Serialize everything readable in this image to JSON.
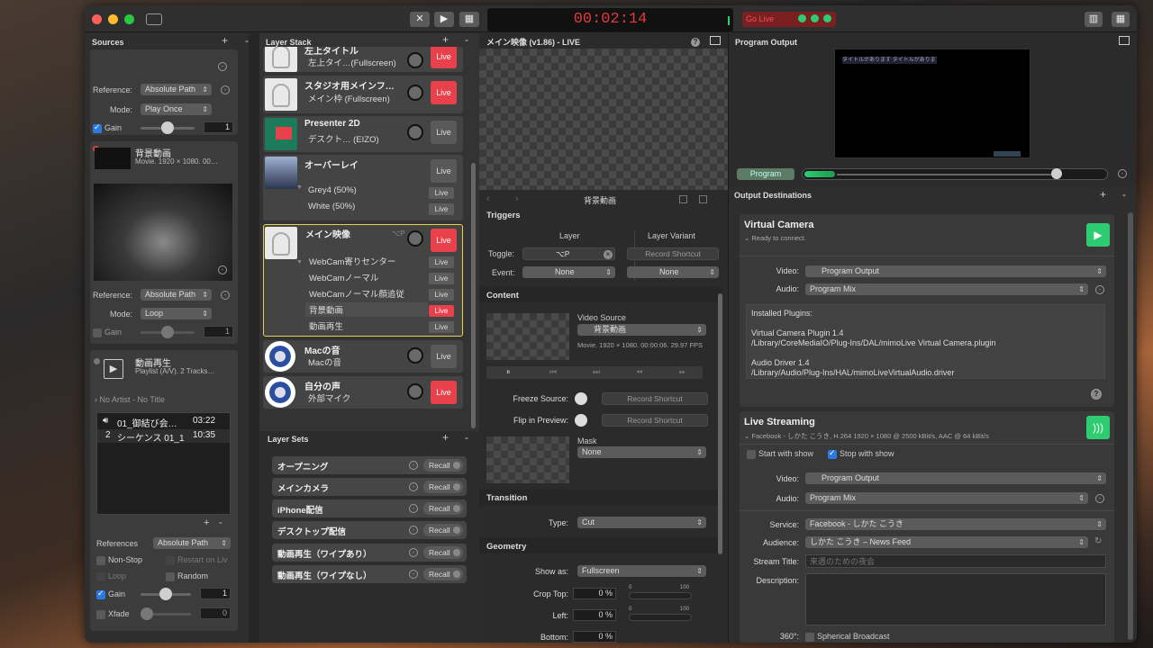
{
  "toolbar": {
    "timer": "00:02:14",
    "go_live_label": "Go Live"
  },
  "sources": {
    "header": "Sources",
    "video": {
      "reference_label": "Reference:",
      "reference_value": "Absolute Path",
      "mode_label": "Mode:",
      "mode_value": "Play Once",
      "gain_label": "Gain",
      "gain_value": "1"
    },
    "movie": {
      "title": "背景動画",
      "meta": "Movie. 1920 × 1080. 00…",
      "reference_label": "Reference:",
      "reference_value": "Absolute Path",
      "mode_label": "Mode:",
      "mode_value": "Loop",
      "gain_label": "Gain",
      "gain_value": "1"
    },
    "playlist": {
      "title": "動画再生",
      "meta": "Playlist (A/V). 2 Tracks…",
      "now_playing": "No Artist - No Title",
      "tracks": [
        {
          "num": "",
          "name": "01_御結び会…",
          "time": "03:22"
        },
        {
          "num": "2",
          "name": "シーケンス 01_1",
          "time": "10:35"
        }
      ],
      "references_label": "References",
      "references_value": "Absolute Path",
      "non_stop": "Non-Stop",
      "restart": "Restart on Liv",
      "loop": "Loop",
      "random": "Random",
      "gain_label": "Gain",
      "gain_value": "1",
      "xfade_label": "Xfade",
      "xfade_value": "0"
    }
  },
  "layer_stack": {
    "header": "Layer Stack",
    "live_label": "Live",
    "layers": [
      {
        "name": "左上タイトル",
        "sub": "左上タイ…(Fullscreen)"
      },
      {
        "name": "スタジオ用メインフ…",
        "sub": "メイン枠 (Fullscreen)"
      },
      {
        "name": "Presenter 2D",
        "sub": "デスクト… (EIZO)"
      },
      {
        "name": "オーバーレイ",
        "variants": [
          "Grey4 (50%)",
          "White (50%)"
        ]
      },
      {
        "name": "メイン映像",
        "shortcut": "⌥P",
        "variants": [
          "WebCam寄りセンター",
          "WebCamノーマル",
          "WebCamノーマル顔追従",
          "背景動画",
          "動画再生"
        ]
      },
      {
        "name": "Macの音",
        "sub": "Macの音"
      },
      {
        "name": "自分の声",
        "sub": "外部マイク"
      }
    ]
  },
  "layer_sets": {
    "header": "Layer Sets",
    "recall_label": "Recall",
    "items": [
      "オープニング",
      "メインカメラ",
      "iPhone配信",
      "デスクトップ配信",
      "動画再生（ワイプあり）",
      "動画再生（ワイプなし）"
    ]
  },
  "inspector": {
    "title": "メイン映像 (v1.86) - LIVE",
    "variant_title": "背景動画",
    "triggers": {
      "header": "Triggers",
      "col_layer": "Layer",
      "col_variant": "Layer Variant",
      "toggle_label": "Toggle:",
      "toggle_value": "⌥P",
      "record_shortcut": "Record Shortcut",
      "event_label": "Event:",
      "event_value": "None",
      "variant_event_value": "None"
    },
    "content": {
      "header": "Content",
      "video_source_label": "Video Source",
      "video_source_value": "背景動画",
      "meta": "Movie. 1920 × 1080. 00:00:06. 29.97 FPS",
      "freeze_label": "Freeze Source:",
      "flip_label": "Flip in Preview:",
      "record_shortcut": "Record Shortcut",
      "mask_label": "Mask",
      "mask_value": "None"
    },
    "transition": {
      "header": "Transition",
      "type_label": "Type:",
      "type_value": "Cut"
    },
    "geometry": {
      "header": "Geometry",
      "show_as_label": "Show as:",
      "show_as_value": "Fullscreen",
      "crop_top_label": "Crop Top:",
      "crop_top_value": "0 %",
      "left_label": "Left:",
      "left_value": "0 %",
      "bottom_label": "Bottom:",
      "bottom_value": "0 %",
      "scale_min": "0",
      "scale_max": "100"
    }
  },
  "program": {
    "header": "Program Output",
    "button": "Program",
    "preview_text": "タイトルがあります タイトルがあります",
    "level": 0.82
  },
  "destinations": {
    "header": "Output Destinations",
    "virtual_camera": {
      "title": "Virtual Camera",
      "status": "Ready to connect.",
      "video_label": "Video:",
      "video_value": "Program Output",
      "audio_label": "Audio:",
      "audio_value": "Program Mix",
      "plugins": [
        "Installed Plugins:",
        "",
        "Virtual Camera Plugin 1.4",
        "/Library/CoreMediaIO/Plug-Ins/DAL/mimoLive Virtual Camera.plugin",
        "",
        "Audio Driver 1.4",
        "/Library/Audio/Plug-Ins/HAL/mimoLiveVirtualAudio.driver"
      ]
    },
    "live_streaming": {
      "title": "Live Streaming",
      "meta": "Facebook - しかた こうき, H.264 1920 × 1080 @ 2500 kBit/s, AAC @ 64 kBit/s",
      "start_with_show": "Start with show",
      "stop_with_show": "Stop with show",
      "video_label": "Video:",
      "video_value": "Program Output",
      "audio_label": "Audio:",
      "audio_value": "Program Mix",
      "service_label": "Service:",
      "service_value": "Facebook - しかた こうき",
      "audience_label": "Audience:",
      "audience_value": "しかた こうき – News Feed",
      "stream_title_label": "Stream Title:",
      "stream_title_placeholder": "来週のための夜会",
      "description_label": "Description:",
      "spherical_label": "360°:",
      "spherical_value": "Spherical Broadcast"
    }
  },
  "colors": {
    "live_red": "#e8414b",
    "accent_blue": "#2a7ae2",
    "green": "#2ecc71",
    "timer_red": "#e23a3a"
  }
}
